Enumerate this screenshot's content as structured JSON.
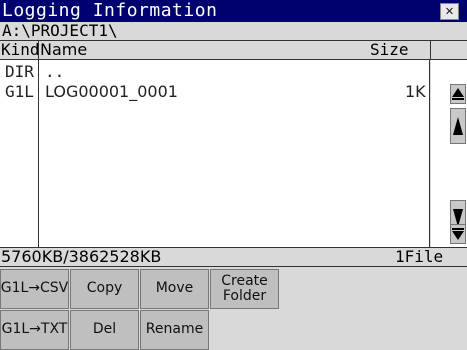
{
  "window": {
    "title": "Logging Information",
    "close_label": "✕",
    "path": "A:\\PROJECT1\\"
  },
  "columns": {
    "kind": "Kind",
    "name": "Name",
    "size": "Size"
  },
  "rows": [
    {
      "kind": "DIR",
      "name": "..",
      "size": ""
    },
    {
      "kind": "G1L",
      "name": "LOG00001_0001",
      "size": "1K"
    }
  ],
  "status": {
    "capacity": "5760KB/3862528KB",
    "count": "1File"
  },
  "buttons": {
    "g1l_csv": "G1L→CSV",
    "copy": "Copy",
    "move": "Move",
    "create_folder_line1": "Create",
    "create_folder_line2": "Folder",
    "g1l_txt": "G1L→TXT",
    "del": "Del",
    "rename": "Rename"
  },
  "colors": {
    "titlebar": "#00006e",
    "background": "#d9d9d9",
    "button": "#bfbfbf"
  }
}
